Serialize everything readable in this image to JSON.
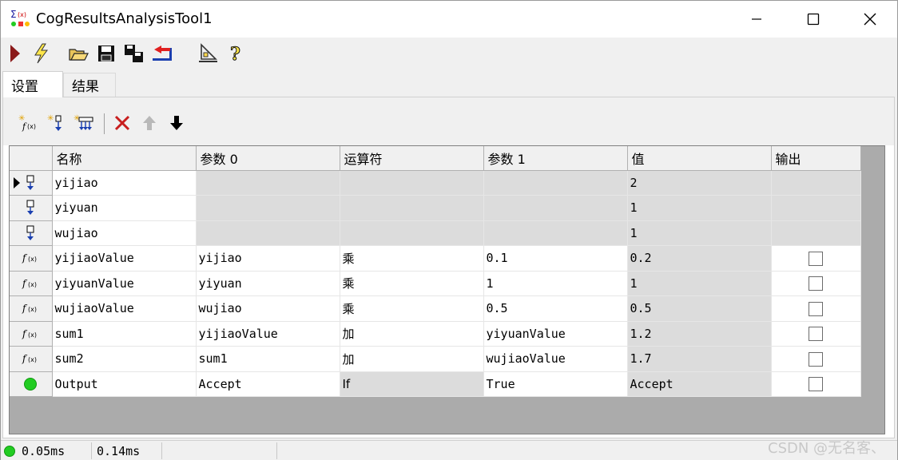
{
  "window": {
    "title": "CogResultsAnalysisTool1",
    "minimize_glyph": "—",
    "maximize_glyph": "☐",
    "close_glyph": "✕"
  },
  "toolbar": {
    "buttons": [
      {
        "name": "run-icon"
      },
      {
        "name": "lightning-icon"
      },
      {
        "name": "open-folder-icon"
      },
      {
        "name": "save-icon"
      },
      {
        "name": "save-as-icon"
      },
      {
        "name": "reset-icon"
      },
      {
        "name": "edit-tool-icon"
      },
      {
        "name": "help-icon"
      }
    ]
  },
  "tabs": [
    {
      "label": "设置",
      "active": true
    },
    {
      "label": "结果",
      "active": false
    }
  ],
  "panel_toolbar": {
    "buttons": [
      "add-expression-icon",
      "add-input-icon",
      "add-multiple-inputs-icon",
      "delete-icon",
      "move-up-icon",
      "move-down-icon"
    ]
  },
  "grid": {
    "columns": [
      "名称",
      "参数 0",
      "运算符",
      "参数 1",
      "值",
      "输出"
    ],
    "rows": [
      {
        "icon": "input-icon",
        "current": true,
        "name": "yijiao",
        "param0": "",
        "operator": "",
        "param1": "",
        "value": "2",
        "output": null
      },
      {
        "icon": "input-icon",
        "current": false,
        "name": "yiyuan",
        "param0": "",
        "operator": "",
        "param1": "",
        "value": "1",
        "output": null
      },
      {
        "icon": "input-icon",
        "current": false,
        "name": "wujiao",
        "param0": "",
        "operator": "",
        "param1": "",
        "value": "1",
        "output": null
      },
      {
        "icon": "function-icon",
        "current": false,
        "name": "yijiaoValue",
        "param0": "yijiao",
        "operator": "乘",
        "param1": "0.1",
        "value": "0.2",
        "output": false
      },
      {
        "icon": "function-icon",
        "current": false,
        "name": "yiyuanValue",
        "param0": "yiyuan",
        "operator": "乘",
        "param1": "1",
        "value": "1",
        "output": false
      },
      {
        "icon": "function-icon",
        "current": false,
        "name": "wujiaoValue",
        "param0": "wujiao",
        "operator": "乘",
        "param1": "0.5",
        "value": "0.5",
        "output": false
      },
      {
        "icon": "function-icon",
        "current": false,
        "name": "sum1",
        "param0": "yijiaoValue",
        "operator": "加",
        "param1": "yiyuanValue",
        "value": "1.2",
        "output": false
      },
      {
        "icon": "function-icon",
        "current": false,
        "name": "sum2",
        "param0": "sum1",
        "operator": "加",
        "param1": "wujiaoValue",
        "value": "1.7",
        "output": false
      },
      {
        "icon": "status-green-icon",
        "current": false,
        "name": "Output",
        "param0": "Accept",
        "operator": "If",
        "param1": "True",
        "value": "Accept",
        "output": false
      }
    ]
  },
  "statusbar": {
    "time1": "0.05ms",
    "time2": "0.14ms",
    "status_color": "#22cc22"
  },
  "watermark": "CSDN @无名客、"
}
